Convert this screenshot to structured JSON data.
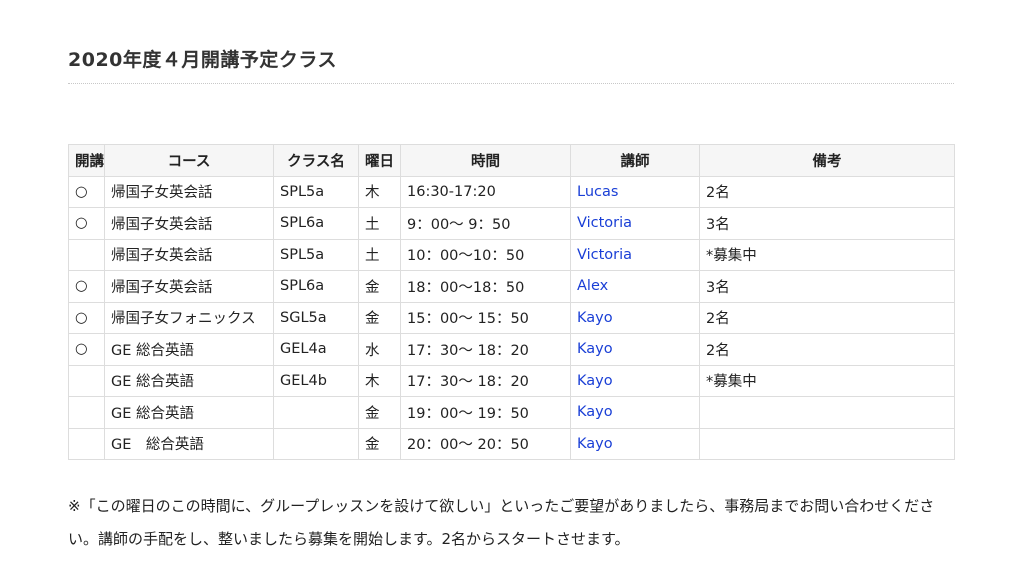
{
  "heading": "2020年度４月開講予定クラス",
  "table": {
    "headers": [
      "開講",
      "コース",
      "クラス名",
      "曜日",
      "時間",
      "講師",
      "備考"
    ],
    "rows": [
      [
        "○",
        "帰国子女英会話",
        "SPL5a",
        "木",
        "16:30-17:20",
        "Lucas",
        "2名"
      ],
      [
        "○",
        "帰国子女英会話",
        "SPL6a",
        "土",
        "9：00～ 9：50",
        "Victoria",
        "3名"
      ],
      [
        "",
        "帰国子女英会話",
        "SPL5a",
        "土",
        "10：00～10：50",
        "Victoria",
        "*募集中"
      ],
      [
        "○",
        "帰国子女英会話",
        "SPL6a",
        "金",
        "18：00～18：50",
        "Alex",
        "3名"
      ],
      [
        "○",
        "帰国子女フォニックス",
        "SGL5a",
        "金",
        "15：00～ 15：50",
        "Kayo",
        "2名"
      ],
      [
        "○",
        "GE 総合英語",
        "GEL4a",
        "水",
        "17：30～ 18：20",
        "Kayo",
        "2名"
      ],
      [
        "",
        "GE 総合英語",
        "GEL4b",
        "木",
        "17：30～ 18：20",
        "Kayo",
        "*募集中"
      ],
      [
        "",
        "GE 総合英語",
        "",
        "金",
        "19：00～ 19：50",
        "Kayo",
        ""
      ],
      [
        "",
        "GE　総合英語",
        "",
        "金",
        "20：00～ 20：50",
        "Kayo",
        ""
      ]
    ]
  },
  "note": "※「この曜日のこの時間に、グループレッスンを設けて欲しい」といったご要望がありましたら、事務局までお問い合わせください。講師の手配をし、整いましたら募集を開始します。2名からスタートさせます。",
  "colors": {
    "teacher_link": "#1a3fd6",
    "header_bg": "#f6f6f6",
    "border": "#dddddd"
  }
}
